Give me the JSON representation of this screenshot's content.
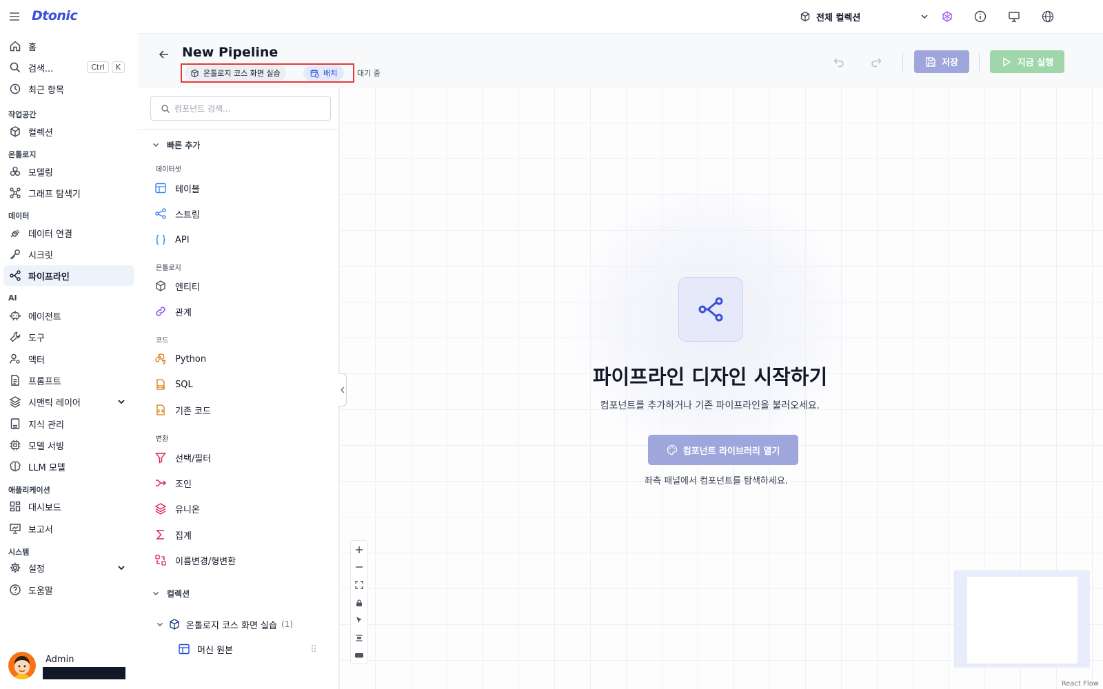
{
  "topbar": {
    "logo": "Dtonic",
    "collection_select": "전체 컬렉션"
  },
  "sidebar": {
    "items": [
      {
        "label": "홈",
        "icon": "home-icon"
      },
      {
        "label": "검색...",
        "icon": "search-icon"
      },
      {
        "label": "최근 항목",
        "icon": "clock-icon"
      },
      {
        "label": "컬렉션",
        "icon": "cube-icon"
      },
      {
        "label": "모델링",
        "icon": "circles-icon"
      },
      {
        "label": "그래프 탐색기",
        "icon": "graph-icon"
      },
      {
        "label": "데이터 연결",
        "icon": "plug-icon"
      },
      {
        "label": "시크릿",
        "icon": "key-icon"
      },
      {
        "label": "파이프라인",
        "icon": "pipeline-icon"
      },
      {
        "label": "에이전트",
        "icon": "robot-icon"
      },
      {
        "label": "도구",
        "icon": "wrench-icon"
      },
      {
        "label": "액터",
        "icon": "user-gear-icon"
      },
      {
        "label": "프롬프트",
        "icon": "document-icon"
      },
      {
        "label": "시맨틱 레이어",
        "icon": "layers-icon"
      },
      {
        "label": "지식 관리",
        "icon": "book-icon"
      },
      {
        "label": "모델 서빙",
        "icon": "chip-icon"
      },
      {
        "label": "LLM 모델",
        "icon": "brain-icon"
      },
      {
        "label": "대시보드",
        "icon": "dashboard-icon"
      },
      {
        "label": "보고서",
        "icon": "presentation-icon"
      },
      {
        "label": "설정",
        "icon": "gear-icon"
      },
      {
        "label": "도움말",
        "icon": "help-icon"
      }
    ],
    "sections": [
      "작업공간",
      "온톨로지",
      "데이터",
      "AI",
      "애플리케이션",
      "시스템"
    ],
    "shortcut": [
      "Ctrl",
      "K"
    ],
    "user": {
      "name": "Admin"
    }
  },
  "header": {
    "title": "New Pipeline",
    "collection_tag": "온톨로지 코스 화면 실습",
    "mode_tag": "배치",
    "status": "대기 중",
    "save_label": "저장",
    "run_label": "지금 실행"
  },
  "panel": {
    "search_placeholder": "컴포넌트 검색...",
    "quick_add": "빠른 추가",
    "categories": [
      "데이터셋",
      "온톨로지",
      "코드",
      "변환"
    ],
    "items": [
      {
        "label": "테이블",
        "icon": "table-icon",
        "color": "#3b82f6"
      },
      {
        "label": "스트림",
        "icon": "stream-icon",
        "color": "#3b82f6"
      },
      {
        "label": "API",
        "icon": "braces-icon",
        "color": "#3b82f6"
      },
      {
        "label": "엔티티",
        "icon": "cube-icon",
        "color": "#4b5563"
      },
      {
        "label": "관계",
        "icon": "link-icon",
        "color": "#7c3aed"
      },
      {
        "label": "Python",
        "icon": "python-icon",
        "color": "#d97706"
      },
      {
        "label": "SQL",
        "icon": "sql-icon",
        "color": "#d97706"
      },
      {
        "label": "기존 코드",
        "icon": "code-file-icon",
        "color": "#d97706"
      },
      {
        "label": "선택/필터",
        "icon": "filter-icon",
        "color": "#e11d48"
      },
      {
        "label": "조인",
        "icon": "join-icon",
        "color": "#e11d48"
      },
      {
        "label": "유니온",
        "icon": "layers-icon",
        "color": "#e11d48"
      },
      {
        "label": "집계",
        "icon": "sigma-icon",
        "color": "#e11d48"
      },
      {
        "label": "이름변경/형변환",
        "icon": "rename-icon",
        "color": "#e11d48"
      }
    ],
    "collections_head": "컬렉션",
    "tree": {
      "collection": "온톨로지 코스 화면 실습",
      "count": "(1)",
      "child": "머신 원본"
    }
  },
  "canvas": {
    "title": "파이프라인 디자인 시작하기",
    "subtitle": "컴포넌트를 추가하거나 기존 파이프라인을 불러오세요.",
    "button": "컴포넌트 라이브러리 열기",
    "hint": "좌측 패널에서 컴포넌트를 탐색하세요.",
    "attribution": "React Flow"
  },
  "colors": {
    "accent": "#3b4fd8",
    "save_button": "#9ea6dc",
    "run_button": "#9fd6aa",
    "highlight": "#e53935"
  }
}
